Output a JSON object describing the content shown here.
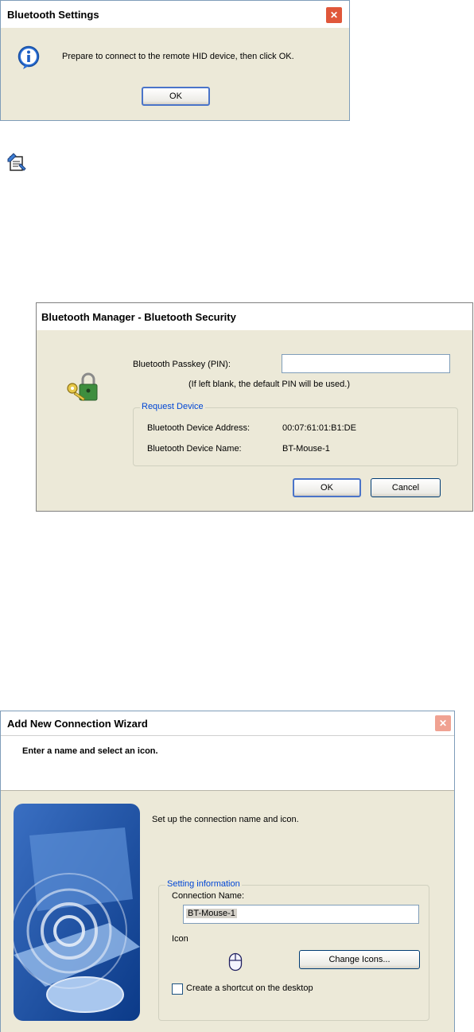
{
  "dialog1": {
    "title": "Bluetooth Settings",
    "message": "Prepare to connect to the remote HID device, then click OK.",
    "ok_label": "OK",
    "close_label": "✕",
    "icon": "info-icon"
  },
  "note_icon": "note-icon",
  "dialog2": {
    "title": "Bluetooth Manager - Bluetooth Security",
    "passkey_label": "Bluetooth Passkey (PIN):",
    "passkey_value": "",
    "hint": "(If left blank, the default PIN will be used.)",
    "group_label": "Request Device",
    "address_label": "Bluetooth Device Address:",
    "address_value": "00:07:61:01:B1:DE",
    "name_label": "Bluetooth Device Name:",
    "name_value": "BT-Mouse-1",
    "ok_label": "OK",
    "cancel_label": "Cancel",
    "icon": "lock-key-icon"
  },
  "wizard": {
    "title": "Add New Connection Wizard",
    "close_label": "✕",
    "header": "Enter a name and select an icon.",
    "intro": "Set up the connection name and icon.",
    "group_label": "Setting information",
    "connection_name_label": "Connection Name:",
    "connection_name_value": "BT-Mouse-1",
    "icon_label": "Icon",
    "change_icons_label": "Change Icons...",
    "shortcut_label": "Create a shortcut on the desktop",
    "shortcut_checked": false
  }
}
